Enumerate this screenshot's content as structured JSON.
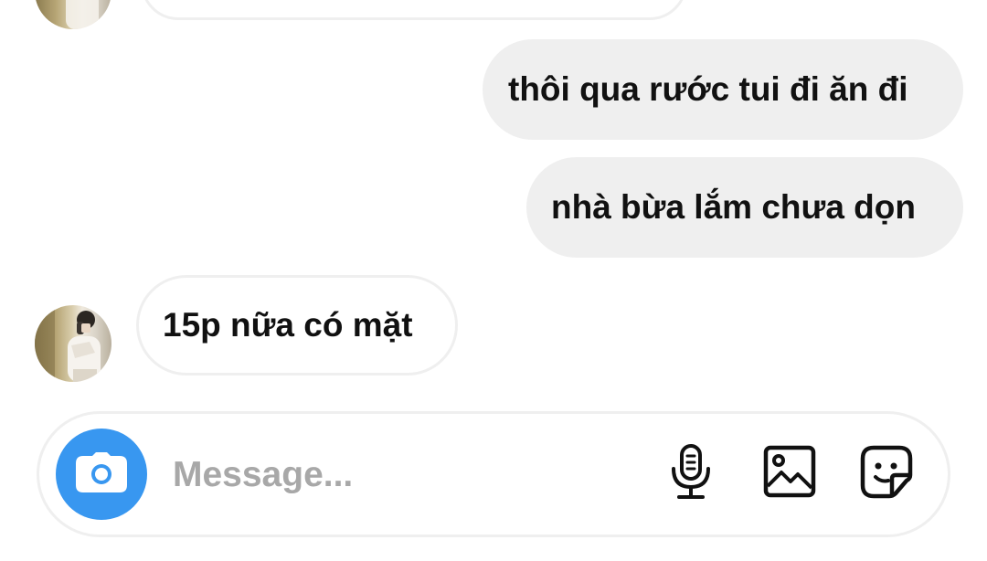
{
  "thread": {
    "messages": [
      {
        "direction": "incoming",
        "text": ""
      },
      {
        "direction": "outgoing",
        "text": "thôi qua rước tui đi ăn đi"
      },
      {
        "direction": "outgoing",
        "text": "nhà bừa lắm chưa dọn"
      },
      {
        "direction": "incoming",
        "text": "15p nữa có mặt"
      }
    ]
  },
  "composer": {
    "placeholder": "Message...",
    "value": "",
    "icons": {
      "camera": "camera-icon",
      "voice": "microphone-icon",
      "gallery": "gallery-icon",
      "sticker": "sticker-icon"
    }
  },
  "colors": {
    "accent": "#3897f0",
    "outgoing_bubble": "#efefef",
    "incoming_border": "#efefef",
    "placeholder": "#a8a8a8",
    "text": "#111111"
  }
}
